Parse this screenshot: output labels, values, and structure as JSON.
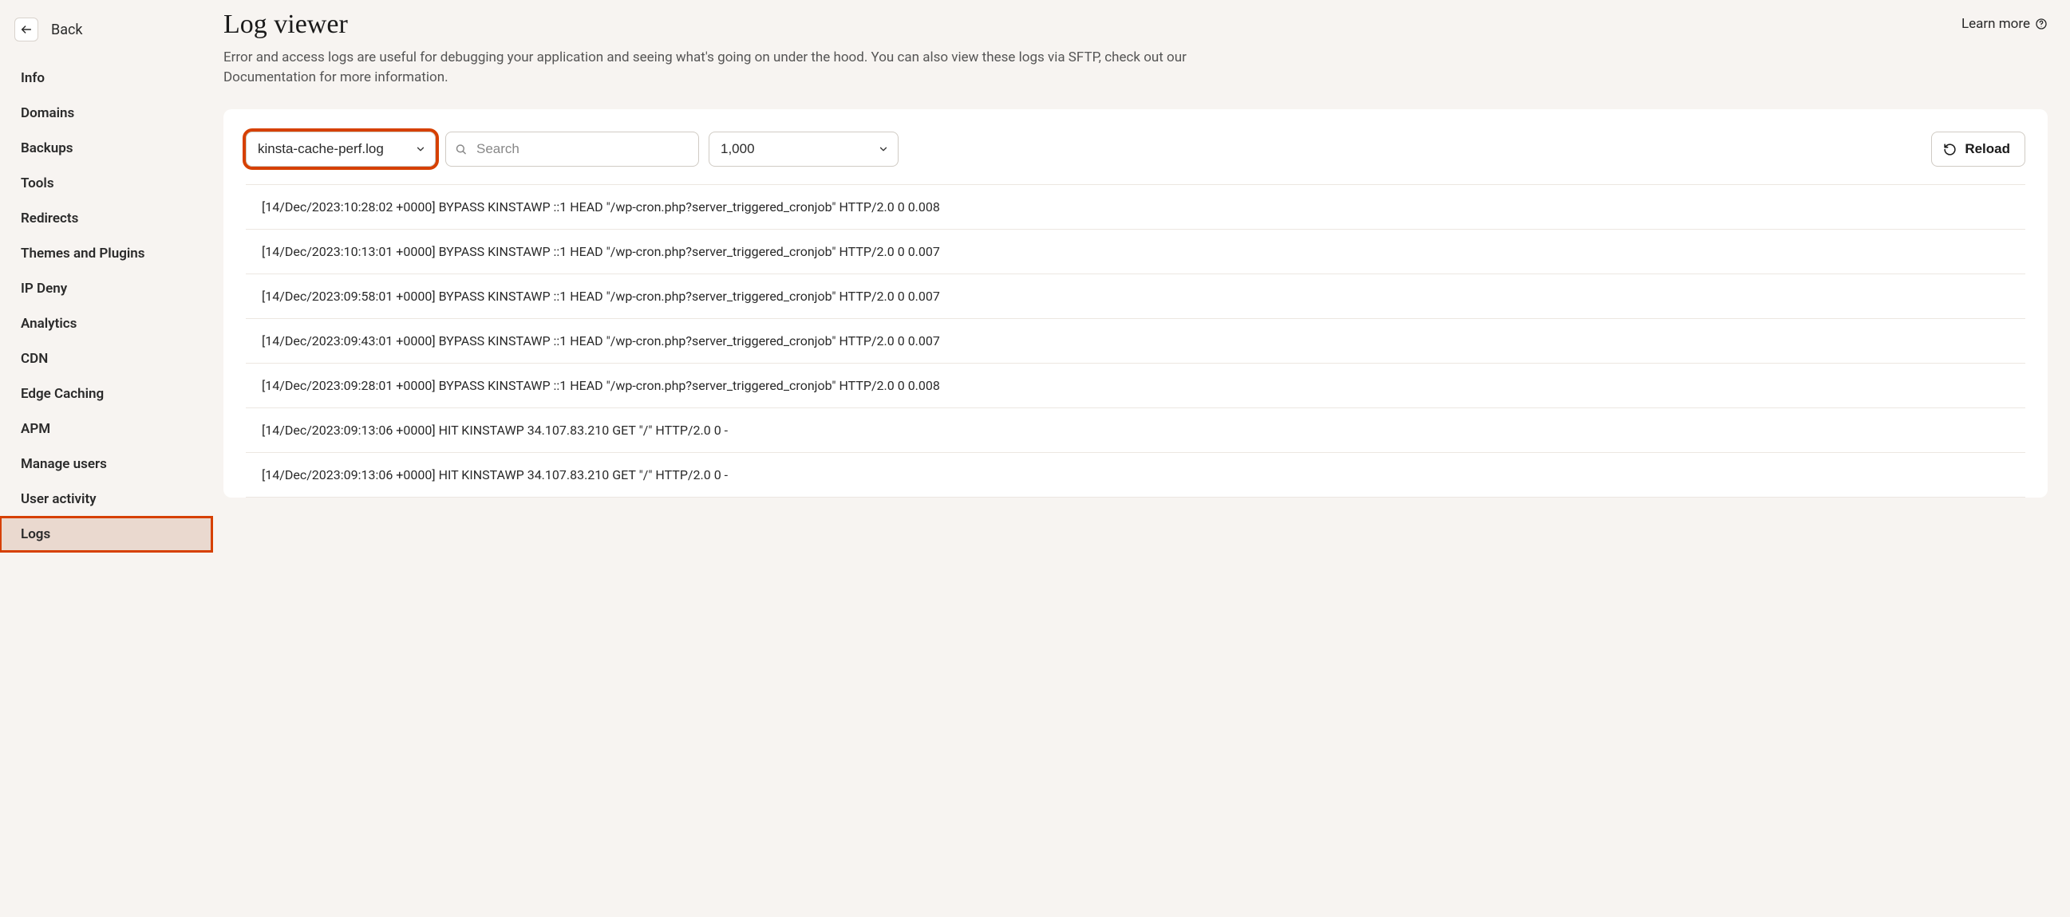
{
  "back": {
    "label": "Back"
  },
  "sidebar": {
    "items": [
      {
        "label": "Info",
        "active": false
      },
      {
        "label": "Domains",
        "active": false
      },
      {
        "label": "Backups",
        "active": false
      },
      {
        "label": "Tools",
        "active": false
      },
      {
        "label": "Redirects",
        "active": false
      },
      {
        "label": "Themes and Plugins",
        "active": false
      },
      {
        "label": "IP Deny",
        "active": false
      },
      {
        "label": "Analytics",
        "active": false
      },
      {
        "label": "CDN",
        "active": false
      },
      {
        "label": "Edge Caching",
        "active": false
      },
      {
        "label": "APM",
        "active": false
      },
      {
        "label": "Manage users",
        "active": false
      },
      {
        "label": "User activity",
        "active": false
      },
      {
        "label": "Logs",
        "active": true
      }
    ]
  },
  "page": {
    "title": "Log viewer",
    "learn_more": "Learn more",
    "description": "Error and access logs are useful for debugging your application and seeing what's going on under the hood. You can also view these logs via SFTP, check out our Documentation for more information."
  },
  "toolbar": {
    "log_select": "kinsta-cache-perf.log",
    "search_placeholder": "Search",
    "count_select": "1,000",
    "reload_label": "Reload"
  },
  "logs": [
    "[14/Dec/2023:10:28:02 +0000] BYPASS KINSTAWP ::1 HEAD \"/wp-cron.php?server_triggered_cronjob\" HTTP/2.0 0 0.008",
    "[14/Dec/2023:10:13:01 +0000] BYPASS KINSTAWP ::1 HEAD \"/wp-cron.php?server_triggered_cronjob\" HTTP/2.0 0 0.007",
    "[14/Dec/2023:09:58:01 +0000] BYPASS KINSTAWP ::1 HEAD \"/wp-cron.php?server_triggered_cronjob\" HTTP/2.0 0 0.007",
    "[14/Dec/2023:09:43:01 +0000] BYPASS KINSTAWP ::1 HEAD \"/wp-cron.php?server_triggered_cronjob\" HTTP/2.0 0 0.007",
    "[14/Dec/2023:09:28:01 +0000] BYPASS KINSTAWP ::1 HEAD \"/wp-cron.php?server_triggered_cronjob\" HTTP/2.0 0 0.008",
    "[14/Dec/2023:09:13:06 +0000] HIT KINSTAWP 34.107.83.210 GET \"/\" HTTP/2.0 0 -",
    "[14/Dec/2023:09:13:06 +0000] HIT KINSTAWP 34.107.83.210 GET \"/\" HTTP/2.0 0 -"
  ],
  "highlights": {
    "log_select": true,
    "logs_nav": true
  }
}
